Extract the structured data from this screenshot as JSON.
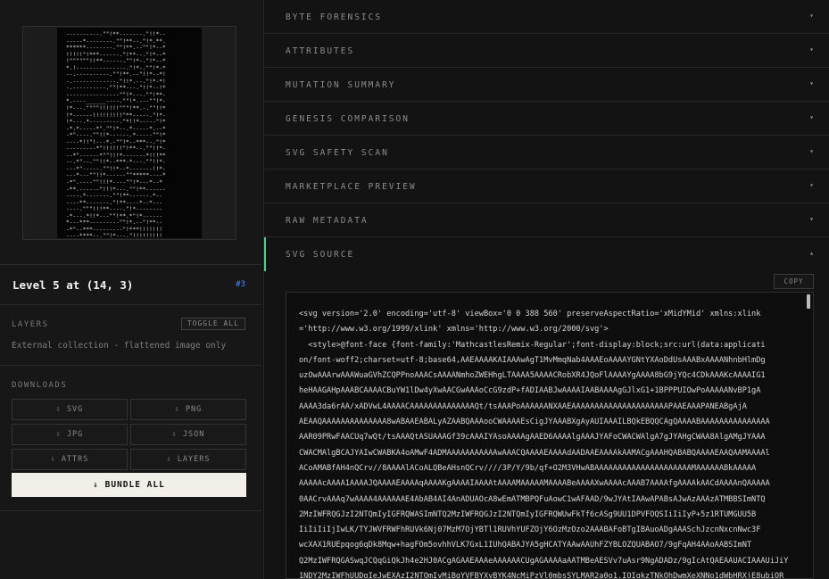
{
  "preview": {
    "art_lines": [
      "----------.\"\"!**-------.\"!!*--",
      "-----*--------.\"\"!**--.\"!*.**.",
      "******--------.\"\"!**.--\"\"!*--*",
      "!!!!!\"!***------.\"!**--.\"!*--*",
      "!\"\"\"\"\"\"!!**------.\"\"!*-.\"!*--*",
      "*.!---------------.\"!*-.\"\"!*-*",
      "--.----------.\"\"!**.--\"!!*--*!",
      "-.-------------.\"!!*.--.\"!*-*!",
      "-.----------.\"\"!**---.\"!!*--!*",
      "----------------\"\"!*---.\"\"!**-",
      "*.----______----.\"\"!*.---\"\"!*-",
      "!*---.\"\"\"\"!!!!!!\"\"\"!**.-.\"\"!!*",
      "!*------!!!!!!!!!\"**-----.\"!*-",
      "!*---.*---------.\"*!!*-----\"!*",
      "-*.*-----*\".\"\"!*--.*-----*.--*",
      "-*\"----.\"\"!!*------.*-----\"\"!*",
      "----*!!\"!---*.-\"\"!*--***--.\"!*",
      "---------*\"!!!!!!\"!**--.\"\"!!*-",
      "--*\"------*\"\"!!!*-------*!!!**",
      "--.*\"--.\"\"!!*--***-*---.\"\"!!*-",
      "---*\"-----.\"\"!!*--*-------!!*-",
      "---*---\"\"!!*------\"\"*****----*",
      "-*\".----\"\"!!!*----\"\"!*---*--*",
      "-**.------\"!!!*---.\"\"!**------",
      "----.*-------.\"\"!**------.*--",
      "----**-------.\"!**----*--*---",
      "----.\"\"\"!!!**----.\"!*--------",
      "-*---.*!!*---\"\"!**.*\"!*------",
      "*---***---------\"\"!*.--\"!**--",
      "-*\"--***---------\"!***!!!!!!!",
      "----****--.\"\"!*---.\"!!!!!!!!!",
      "--.*\".---.\"\"!**----_________"
    ]
  },
  "level": {
    "title": "Level 5 at (14, 3)",
    "badge": "#3"
  },
  "layers": {
    "label": "LAYERS",
    "toggle_label": "TOGGLE ALL",
    "text": "External collection - flattened image only"
  },
  "downloads": {
    "label": "DOWNLOADS",
    "buttons": [
      "⇩ SVG",
      "⇩ PNG",
      "⇩ JPG",
      "⇩ JSON",
      "⇩ ATTRS",
      "⇩ LAYERS"
    ],
    "bundle_label": "⇓ BUNDLE ALL"
  },
  "accordion": [
    {
      "label": "BYTE FORENSICS",
      "chevron": "▾"
    },
    {
      "label": "ATTRIBUTES",
      "chevron": "▾"
    },
    {
      "label": "MUTATION SUMMARY",
      "chevron": "▾"
    },
    {
      "label": "GENESIS COMPARISON",
      "chevron": "▾"
    },
    {
      "label": "SVG SAFETY SCAN",
      "chevron": "▾"
    },
    {
      "label": "MARKETPLACE PREVIEW",
      "chevron": "▾"
    },
    {
      "label": "RAW METADATA",
      "chevron": "▾"
    },
    {
      "label": "SVG SOURCE",
      "chevron": "▴"
    }
  ],
  "svg_source": {
    "copy_label": "COPY",
    "lines": [
      "<svg version='2.0' encoding='utf-8' viewBox='0 0 388 560' preserveAspectRatio='xMidYMid' xmlns:xlink",
      "='http://www.w3.org/1999/xlink' xmlns='http://www.w3.org/2000/svg'>",
      "  <style>@font-face {font-family:'MathcastlesRemix-Regular';font-display:block;src:url(data:applicati",
      "on/font-woff2;charset=utf-8;base64,AAEAAAAKAIAAAwAgT1MvMmqNab4AAAEoAAAAYGNtYXAoDdUsAAABxAAAANhnbHlmDg",
      "uzOwAAArwAAAWuaGVhZCQPPnoAAACsAAAANmhoZWEHhgLTAAAA5AAAACRobXR4JQoFlAAAAYgAAAA8bG9jYQc4CDkAAAKcAAAAIG1",
      "heHAAGAHpAAABCAAAACBuYW1lDw4yXwAACGwAAAoCcG9zdP+fADIAABJwAAAAIAABAAAAgGJlxG1+1BPPPUIOwPoAAAAANvBP1gA",
      "AAAA3da6rAA/xADVwL4AAAACAAAAAAAAAAAAAAQt/tsAAAPoAAAAAANXAAEAAAAAAAAAAAAAAAAAAAAAPAAEAAAPANEABgAjA",
      "AEAAQAAAAAAAAAAAAAA8wABAAEABALyAZAABQAAAooCWAAAAEsCigJYAAABXgAyAUIAAAILBQkEBQQCAgQAAAABAAAAAAAAAAAAAAA",
      "AAR09PRwFAACUq7wQt/tsAAAQtASUAAAGf39cAAAIYAsoAAAAgAAED6AAAAlgAAAJYAFoCWACWAlgA7gJYAHgCWAA8AlgAMgJYAAA",
      "CWACMAlgBCAJYAIwCWABKA4oAMwF4ADMAAAAAAAAAAAwAAACQAAAAEAAAAdAADAAEAAAAkAAMACgAAAHQABABQAAAAEAAQAAMAAAAl",
      "ACoAMABfAH4nQCrv//8AAAAlACoALQBeAHsnQCrv////3P/Y/9b/qf+O2M3VHwABAAAAAAAAAAAAAAAAAAAAAMAAAAAABkAAAAA",
      "AAAAAcAAAA1AAAAJQAAAAEAAAAqAAAAKgAAAAIAAAAtAAAAMAAAAAMAAAABeAAAAXwAAAAcAAAB7AAAAfgAAAAkAACdAAAAnQAAAAA",
      "0AACrvAAAq7wAAAA4AAAAAAE4AbAB4AI4AnADUAOcA8wEmATMBPQFuAowC1wAFAAD/9wJYAtIAAwAPABsAJwAzAAAzATMBBSImNTQ",
      "2MzIWFRQGJzI2NTQmIyIGFRQWASImNTQ2MzIWFRQGJzI2NTQmIyIGFRQWUwFkTf6cASg9UU1DPVFOQSIiIiIyP+5z1RTUMGUU5B",
      "IiIiIiIjIwLK/TYJWVFRWFhRUVk6Nj07MzM7OjYBTl1RUVhYUFZOjY6OzMzOzo2AAABAFoBTgIBAuoADgAAASchJzcnNxcnNwc3F",
      "wcXAX1RUEpqog6qDk8Mqw+hagFOm5ovhhVLK7GxL1IUhQABAJYA5gHCATYAAwAAUhFZYBLOZQUABAO7/9gFqAH4AAoAABSImNT",
      "Q2MzIWFRQGASwqJCQqGiQkJh4e2HJ0ACgAGAAEAAAeAAAAAACUgAGAAAAaAATMBeAESVv7uAsr9NgADADz/9gIcAtQAEAAUACIAAAUiJiY",
      "1NDY2MzIWFhUUDgIeJwEXAzI2NTQmIyMiBgYVFBYXyBYK4NcMiPzVl0mbsSYLMAR2a0o1.IOIgkzTNkOhDwmXeXNNo1dWbHRXjE8ubiQR"
    ]
  }
}
